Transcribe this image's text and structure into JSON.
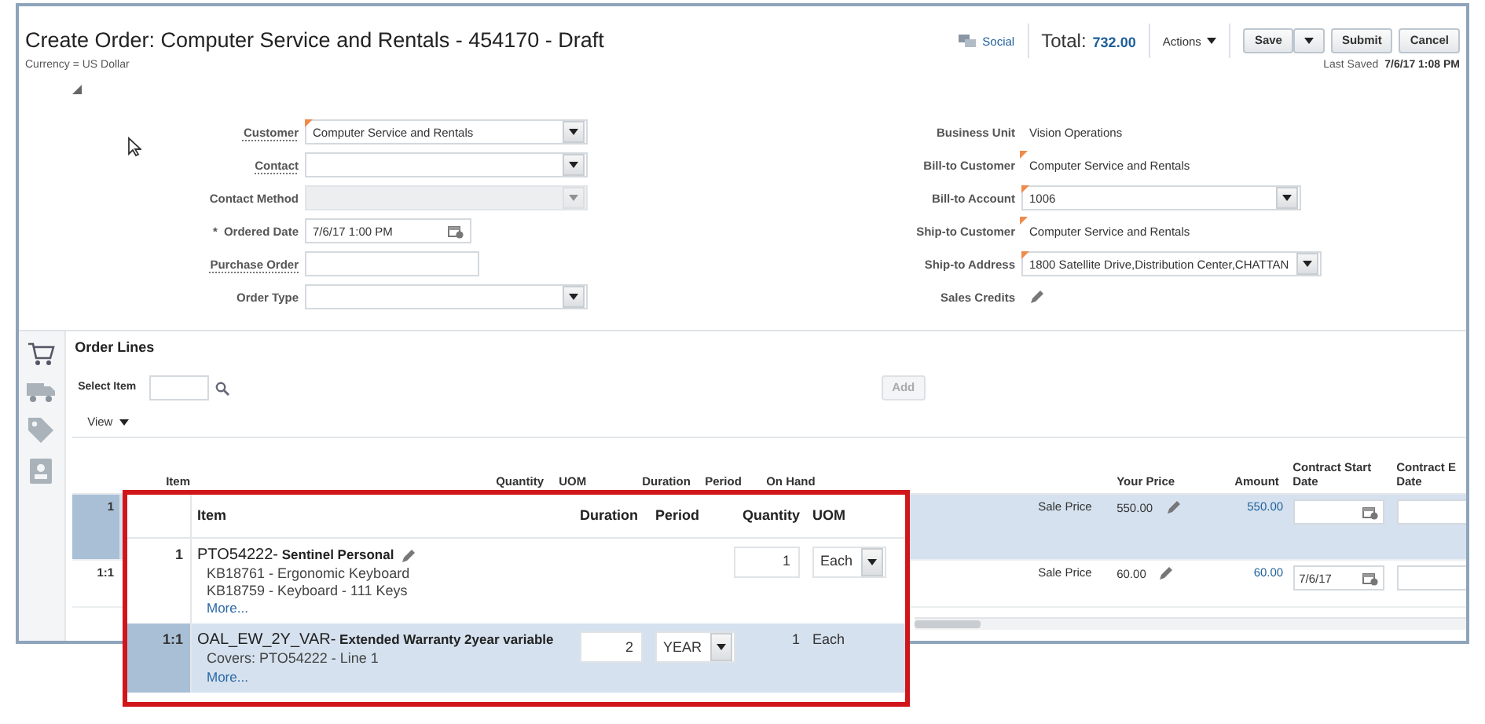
{
  "header": {
    "title": "Create Order: Computer Service and Rentals - 454170 - Draft",
    "currency": "Currency = US Dollar",
    "social": "Social",
    "total_label": "Total:",
    "total": "732.00",
    "actions": "Actions",
    "buttons": [
      {
        "label": "Save",
        "kind": "split"
      },
      {
        "label": "Submit",
        "kind": "plain"
      },
      {
        "label": "Cancel",
        "kind": "plain"
      }
    ],
    "last_saved_label": "Last Saved",
    "last_saved": "7/6/17 1:08 PM"
  },
  "form": {
    "left": [
      {
        "label": "Customer",
        "underlined": true,
        "kind": "select",
        "value": "Computer Service and Rentals",
        "flagged": true,
        "disabled": false
      },
      {
        "label": "Contact",
        "underlined": true,
        "kind": "select",
        "disabled": false
      },
      {
        "label": "Contact Method",
        "underlined": false,
        "kind": "select",
        "disabled": true
      },
      {
        "label": "Ordered Date",
        "required_mark": "*",
        "underlined": false,
        "kind": "date",
        "value": "7/6/17 1:00 PM",
        "disabled": false
      },
      {
        "label": "Purchase Order",
        "underlined": true,
        "kind": "text",
        "disabled": false
      },
      {
        "label": "Order Type",
        "underlined": false,
        "kind": "select",
        "disabled": false
      }
    ],
    "right": [
      {
        "label": "Business Unit",
        "underlined": false,
        "kind": "readonly",
        "value": "Vision Operations"
      },
      {
        "label": "Bill-to Customer",
        "underlined": false,
        "kind": "readonly",
        "value": "Computer Service and Rentals",
        "flagged": true
      },
      {
        "label": "Bill-to Account",
        "underlined": false,
        "kind": "select",
        "value": "1006",
        "flagged": true,
        "disabled": false
      },
      {
        "label": "Ship-to Customer",
        "underlined": false,
        "kind": "readonly",
        "value": "Computer Service and Rentals",
        "flagged": true
      },
      {
        "label": "Ship-to Address",
        "underlined": false,
        "kind": "select",
        "value": "1800 Satellite Drive,Distribution Center,CHATTAN",
        "flagged": true,
        "disabled": false
      },
      {
        "label": "Sales Credits",
        "underlined": false,
        "kind": "icon"
      }
    ]
  },
  "order_lines": {
    "title": "Order Lines",
    "select_item_label": "Select Item",
    "add_button": {
      "label": "Add",
      "disabled": true
    },
    "view_menu": "View",
    "columns": [
      "",
      "Item",
      "Quantity",
      "UOM",
      "Duration",
      "Period",
      "On Hand",
      "",
      "Your Price",
      "Amount",
      "Contract Start\nDate",
      "Contract E\nDate"
    ],
    "rows": [
      {
        "number": "1",
        "selected": true,
        "price_type": "Sale Price",
        "your_price": "550.00",
        "amount": "550.00"
      },
      {
        "number": "1:1",
        "selected": false,
        "price_type": "Sale Price",
        "your_price": "60.00",
        "amount": "60.00",
        "contract_start": "7/6/17"
      }
    ]
  },
  "callout": {
    "columns": [
      "Item",
      "Duration",
      "Period",
      "Quantity",
      "UOM"
    ],
    "rows": [
      {
        "number": "1",
        "selected": false,
        "item_code": "PTO54222-",
        "item_name": "Sentinel Personal",
        "lines": [
          "KB18761 - Ergonomic Keyboard",
          "KB18759 - Keyboard - 111 Keys"
        ],
        "more": "More...",
        "quantity": {
          "kind": "input",
          "value": "1"
        },
        "uom": {
          "kind": "select",
          "value": "Each"
        }
      },
      {
        "number": "1:1",
        "selected": true,
        "item_code": "OAL_EW_2Y_VAR-",
        "item_name": "Extended Warranty 2year variable",
        "lines": [
          "Covers: PTO54222 - Line 1"
        ],
        "more": "More...",
        "duration": "2",
        "period": "YEAR",
        "quantity": {
          "kind": "text",
          "value": "1"
        },
        "uom": {
          "kind": "text",
          "value": "Each"
        }
      }
    ]
  }
}
